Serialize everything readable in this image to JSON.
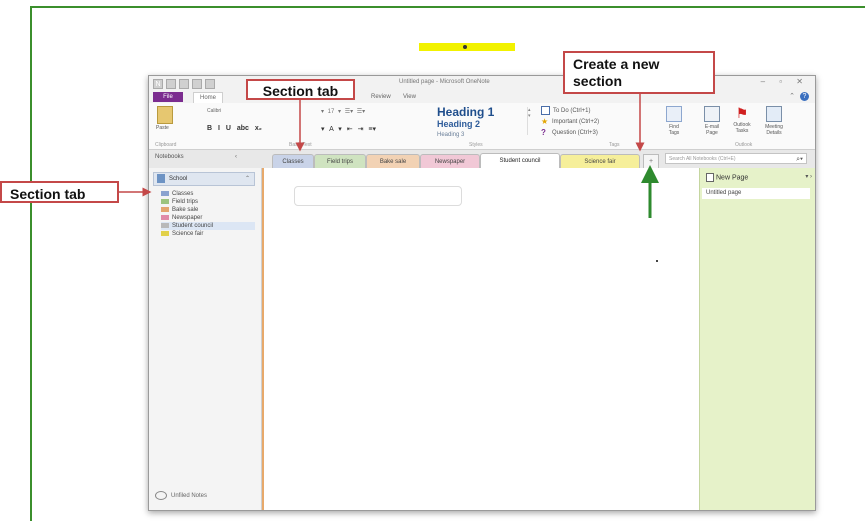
{
  "window": {
    "app_letter": "N",
    "title": "Untitled page - Microsoft OneNote",
    "controls": "– ▫ ✕"
  },
  "ribbon_tabs": {
    "file": "File",
    "home": "Home",
    "review": "Review",
    "view": "View"
  },
  "ribbon": {
    "paste": "Paste",
    "clipboard_group": "Clipboard",
    "font_name": "Calibri",
    "font_size": "17",
    "format_buttons": "B I U abc x₂",
    "basic_text_group": "Basic Text",
    "size_row": "▾ 17 ▾ ☰▾ ☰▾",
    "color_row": "▾ A ▾ ⇤ ⇥ ≡▾",
    "heading1": "Heading 1",
    "heading2": "Heading 2",
    "heading3": "Heading 3",
    "styles_group": "Styles",
    "todo": "To Do (Ctrl+1)",
    "important": "Important (Ctrl+2)",
    "question": "Question (Ctrl+3)",
    "tags_group": "Tags",
    "find_tags": "Find Tags",
    "email_page": "E-mail Page",
    "outlook_tasks": "Outlook Tasks",
    "meeting_details": "Meeting Details",
    "outlook_group": "Outlook"
  },
  "nav": {
    "notebooks_label": "Notebooks",
    "section_tabs": [
      {
        "label": "Classes",
        "color": "#c9d3e8"
      },
      {
        "label": "Field trips",
        "color": "#cfe3c0"
      },
      {
        "label": "Bake sale",
        "color": "#f2d2b4"
      },
      {
        "label": "Newspaper",
        "color": "#f1c8d6"
      },
      {
        "label": "Student council",
        "color": "#ffffff"
      },
      {
        "label": "Science fair",
        "color": "#f6ef9a"
      }
    ],
    "new_section_symbol": "+",
    "search_placeholder": "Search All Notebooks (Ctrl+E)"
  },
  "notebook_pane": {
    "notebook_name": "School",
    "sections": [
      "Classes",
      "Field trips",
      "Bake sale",
      "Newspaper",
      "Student council",
      "Science fair"
    ],
    "selected_section": "Student council",
    "unfiled": "Unfiled Notes"
  },
  "pages_pane": {
    "new_page": "New Page",
    "pages": [
      "Untitled page"
    ]
  },
  "annotations": {
    "section_tab_left": "Section tab",
    "section_tab_top": "Section tab",
    "create_new_section": "Create a new section"
  },
  "colors": {
    "frame_green": "#3b8f2c",
    "callout_red": "#c44848",
    "onenote_purple": "#7b2c8f",
    "highlight_yellow": "#f2f200"
  }
}
